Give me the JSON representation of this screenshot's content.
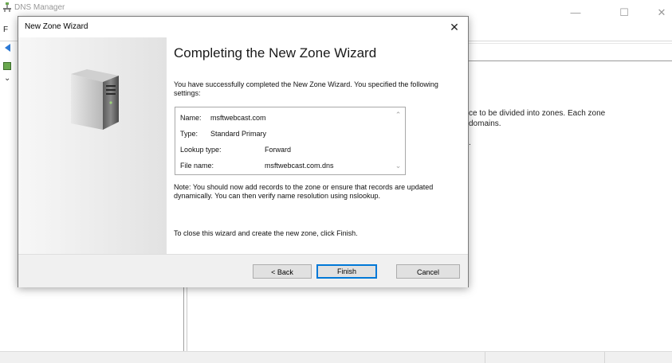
{
  "background_window": {
    "title": "DNS Manager",
    "menu_first_letter": "F",
    "controls": {
      "minimize": "—",
      "maximize": "☐",
      "close": "✕"
    },
    "tree_chevron": "⌄",
    "description_line1": "ce to be divided into zones. Each zone",
    "description_line2": "domains.",
    "description_line3": "."
  },
  "dialog": {
    "title": "New Zone Wizard",
    "close_glyph": "✕",
    "heading": "Completing the New Zone Wizard",
    "intro_text": "You have successfully completed the New Zone Wizard. You specified the following settings:",
    "settings": [
      {
        "label": "Name:",
        "value": "msftwebcast.com"
      },
      {
        "label": "Type:",
        "value": "Standard Primary"
      },
      {
        "label": "Lookup type:",
        "value": "Forward"
      },
      {
        "label": "File name:",
        "value": "msftwebcast.com.dns"
      }
    ],
    "scroll_up": "⌃",
    "scroll_down": "⌄",
    "note_text": "Note: You should now add records to the zone or ensure that records are updated dynamically. You can then verify name resolution using nslookup.",
    "finish_instruction": "To close this wizard and create the new zone, click Finish.",
    "buttons": {
      "back": "< Back",
      "finish": "Finish",
      "cancel": "Cancel"
    }
  },
  "icons": {
    "app": "dns-icon",
    "server": "server-icon",
    "back": "back-arrow-icon"
  }
}
